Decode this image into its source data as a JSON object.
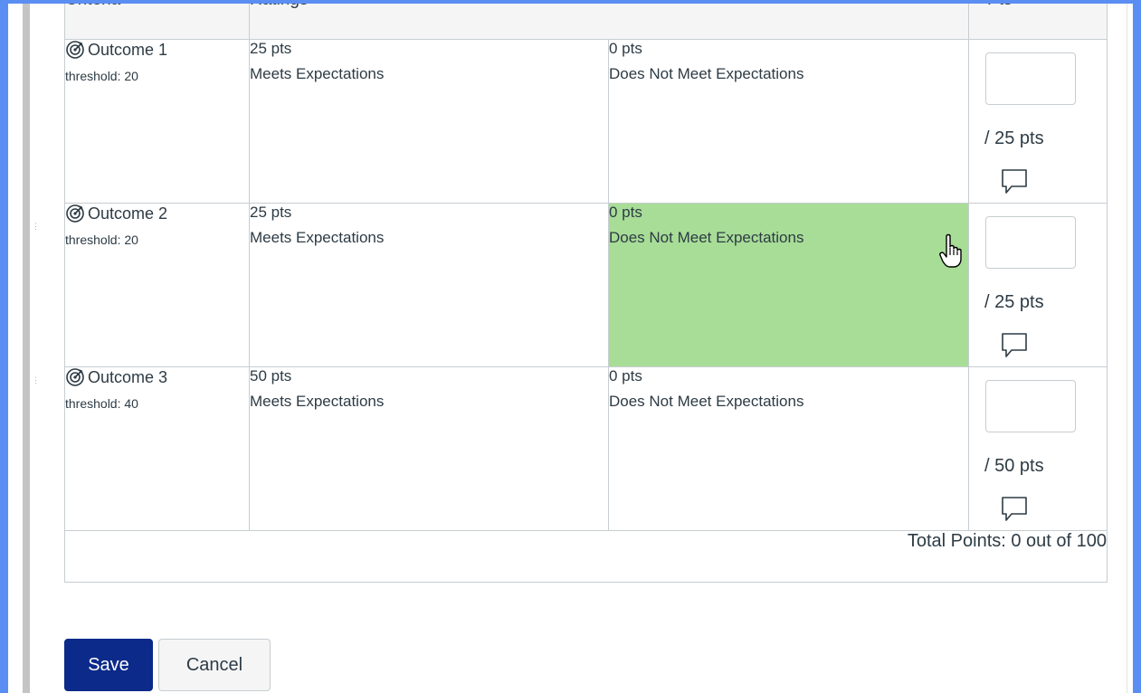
{
  "columns": {
    "criteria": "Criteria",
    "ratings": "Ratings",
    "pts": "Pts"
  },
  "rows": [
    {
      "name": "Outcome 1",
      "threshold": "threshold: 20",
      "ratings": [
        {
          "pts": "25 pts",
          "desc": "Meets Expectations"
        },
        {
          "pts": "0 pts",
          "desc": "Does Not Meet Expectations"
        }
      ],
      "out_of": "/ 25 pts",
      "score_value": ""
    },
    {
      "name": "Outcome 2",
      "threshold": "threshold: 20",
      "ratings": [
        {
          "pts": "25 pts",
          "desc": "Meets Expectations"
        },
        {
          "pts": "0 pts",
          "desc": "Does Not Meet Expectations"
        }
      ],
      "out_of": "/ 25 pts",
      "score_value": ""
    },
    {
      "name": "Outcome 3",
      "threshold": "threshold: 40",
      "ratings": [
        {
          "pts": "50 pts",
          "desc": "Meets Expectations"
        },
        {
          "pts": "0 pts",
          "desc": "Does Not Meet Expectations"
        }
      ],
      "out_of": "/ 50 pts",
      "score_value": ""
    }
  ],
  "selected_rating": {
    "row": 1,
    "rating": 1,
    "color": "#a8dd97"
  },
  "total": "Total Points: 0 out of 100",
  "buttons": {
    "save": "Save",
    "cancel": "Cancel"
  },
  "colors": {
    "save_button": "#0b2a8a",
    "page_border": "#5a8ef2"
  },
  "icons": {
    "outcome": "target-icon",
    "comment": "comment-icon",
    "cursor": "hand-pointer-icon"
  }
}
